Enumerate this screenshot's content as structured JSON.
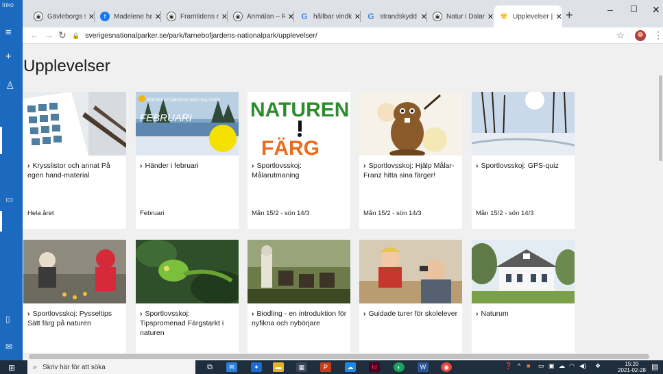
{
  "sidebar": {
    "label": "Inko"
  },
  "tabs": [
    {
      "title": "Gävleborgs st",
      "icon": "chameleon-icon"
    },
    {
      "title": "Madelene han",
      "icon": "facebook-icon"
    },
    {
      "title": "Framtidens m",
      "icon": "chameleon-icon"
    },
    {
      "title": "Anmälan – Rä",
      "icon": "chameleon-icon"
    },
    {
      "title": "hållbar vindkr",
      "icon": "google-icon"
    },
    {
      "title": "strandskydd -",
      "icon": "google-icon"
    },
    {
      "title": "Natur i Dalarn",
      "icon": "chameleon-icon"
    },
    {
      "title": "Upplevelser |",
      "icon": "flower-icon",
      "active": true
    }
  ],
  "address": {
    "url": "sverigesnationalparker.se/park/farnebofjardens-nationalpark/upplevelser/"
  },
  "page": {
    "title": "Upplevelser"
  },
  "cards": [
    {
      "title": "Krysslistor och annat På egen hand-material",
      "date": "Hela året"
    },
    {
      "title": "Händer i februari",
      "date": "Februari",
      "image_text": "FÄRNEBOFJÄRDENS NATIONALPARK",
      "image_big": "FEBRUARI"
    },
    {
      "title": "Sportlovsskoj: Målarutmaning",
      "date": "Mån 15/2 - sön 14/3",
      "image_text": "NATUREN",
      "image_big": "FÄRG"
    },
    {
      "title": "Sportlovsskoj: Hjälp Målar-Franz hitta sina färger!",
      "date": "Mån 15/2 - sön 14/3"
    },
    {
      "title": "Sportlovsskoj: GPS-quiz",
      "date": "Mån 15/2 - sön 14/3"
    },
    {
      "title": "Sportlovsskoj: Pysseltips Sätt färg på naturen",
      "date": ""
    },
    {
      "title": "Sportlovsskoj: Tipspromenad Färgstarkt i naturen",
      "date": ""
    },
    {
      "title": "Biodling - en introduktion för nyfikna och nybörjare",
      "date": ""
    },
    {
      "title": "Guidade turer för skolelever",
      "date": ""
    },
    {
      "title": "Naturum",
      "date": ""
    }
  ],
  "taskbar": {
    "search_placeholder": "Skriv här för att söka",
    "time": "15:20",
    "date": "2021-02-28"
  }
}
